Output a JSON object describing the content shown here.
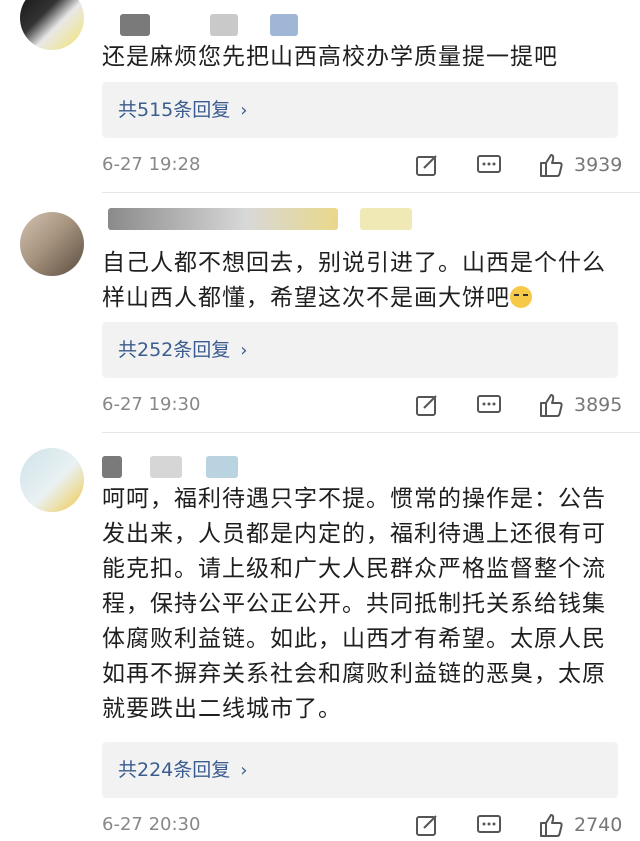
{
  "comments": [
    {
      "text": "还是麻烦您先把山西高校办学质量提一提吧",
      "replies_label": "共515条回复",
      "time": "6-27 19:28",
      "likes": "3939"
    },
    {
      "text": "自己人都不想回去，别说引进了。山西是个什么样山西人都懂，希望这次不是画大饼吧",
      "replies_label": "共252条回复",
      "time": "6-27 19:30",
      "likes": "3895"
    },
    {
      "text": "呵呵，福利待遇只字不提。惯常的操作是：公告发出来，人员都是内定的，福利待遇上还很有可能克扣。请上级和广大人民群众严格监督整个流程，保持公平公正公开。共同抵制托关系给钱集体腐败利益链。如此，山西才有希望。太原人民如再不摒弃关系社会和腐败利益链的恶臭，太原就要跌出二线城市了。",
      "replies_label": "共224条回复",
      "time": "6-27 20:30",
      "likes": "2740"
    }
  ],
  "icons": {
    "share": "share-icon",
    "comment": "comment-icon",
    "like": "thumbs-up-icon",
    "reply_chevron": "chevron-right-icon",
    "emoji": "smirk-emoji-icon"
  },
  "colors": {
    "reply_link": "#3a5c8f",
    "reply_bg": "#f2f2f2",
    "meta_text": "#888888"
  }
}
